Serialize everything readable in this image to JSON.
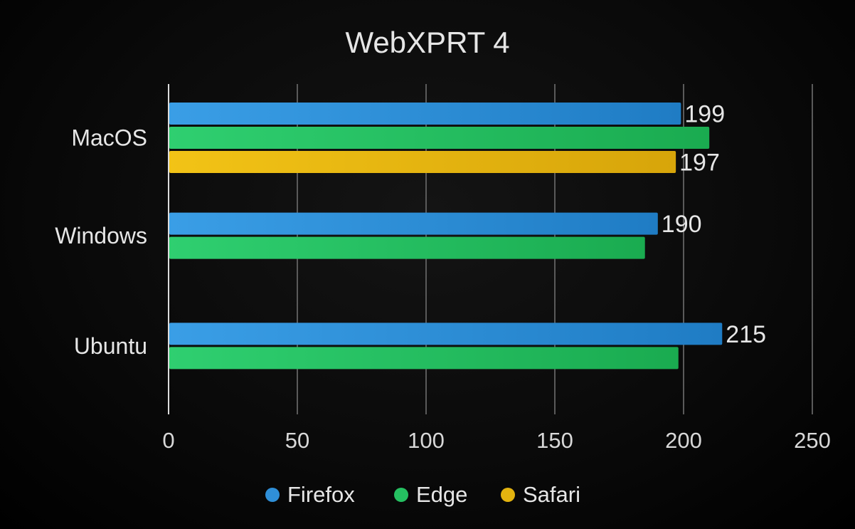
{
  "chart_data": {
    "type": "bar",
    "orientation": "horizontal",
    "title": "WebXPRT 4",
    "xlabel": "",
    "ylabel": "",
    "categories": [
      "MacOS",
      "Windows",
      "Ubuntu"
    ],
    "series": [
      {
        "name": "Firefox",
        "color": "#2f8fd8",
        "values": [
          199,
          190,
          215
        ],
        "labels": [
          "199",
          "190",
          "215"
        ]
      },
      {
        "name": "Edge",
        "color": "#25c061",
        "values": [
          210,
          185,
          198
        ],
        "labels": [
          "",
          "",
          ""
        ]
      },
      {
        "name": "Safari",
        "color": "#e3b30f",
        "values": [
          197,
          null,
          null
        ],
        "labels": [
          "197",
          "",
          ""
        ]
      }
    ],
    "xlim": [
      0,
      250
    ],
    "xticks": [
      0,
      50,
      100,
      150,
      200,
      250
    ],
    "grid": true,
    "legend": "bottom"
  }
}
